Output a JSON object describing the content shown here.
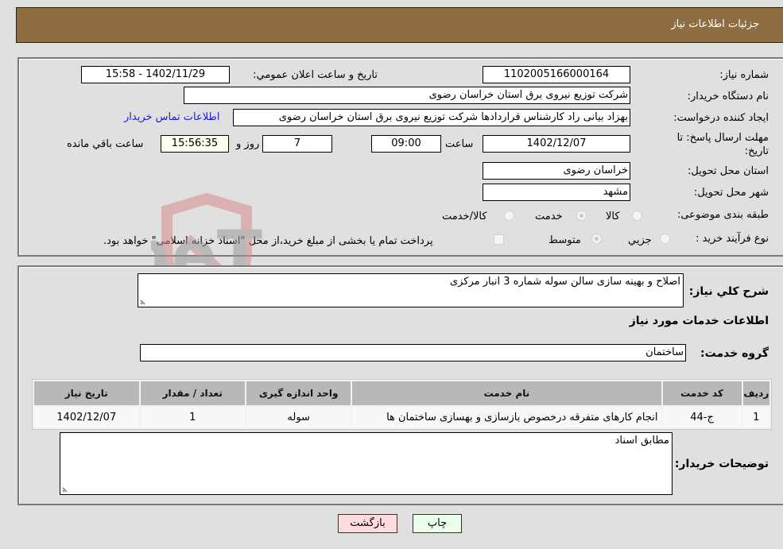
{
  "header": {
    "title": "جزئیات اطلاعات نیاز"
  },
  "form": {
    "need_number_label": "شماره نیاز:",
    "need_number": "1102005166000164",
    "announce_label": "تاریخ و ساعت اعلان عمومي:",
    "announce_value": "1402/11/29 - 15:58",
    "buyer_org_label": "نام دستگاه خریدار:",
    "buyer_org": "شرکت توزیع نیروی برق استان خراسان رضوی",
    "creator_label": "ایجاد کننده درخواست:",
    "creator": "بهزاد بیانی راد کارشناس قراردادها شرکت توزیع نیروی برق استان خراسان رضوی",
    "contact_link": "اطلاعات تماس خریدار",
    "deadline_label_1": "مهلت ارسال پاسخ: تا",
    "deadline_label_2": "تاریخ:",
    "deadline_date": "1402/12/07",
    "time_label": "ساعت",
    "deadline_time": "09:00",
    "days_value": "7",
    "days_label": "روز و",
    "remaining_time": "15:56:35",
    "remaining_label": "ساعت باقي مانده",
    "province_label": "استان محل تحویل:",
    "province": "خراسان رضوی",
    "city_label": "شهر محل تحویل:",
    "city": "مشهد",
    "category_label": "طبقه بندی موضوعی:",
    "category_options": [
      "کالا",
      "خدمت",
      "کالا/خدمت"
    ],
    "category_selected": "خدمت",
    "process_label": "نوع فرآیند خرید :",
    "process_options": [
      "جزيي",
      "متوسط"
    ],
    "process_selected": "متوسط",
    "treasury_note": "پرداخت تمام یا بخشی از مبلغ خرید،از محل \"اسناد خزانه اسلامی\" خواهد بود."
  },
  "details": {
    "description_label": "شرح کلي نیاز:",
    "description": "اصلاح و بهینه سازی سالن سوله شماره 3 انبار مرکزی",
    "services_heading": "اطلاعات خدمات مورد نیاز",
    "service_group_label": "گروه خدمت:",
    "service_group": "ساختمان",
    "table": {
      "headers": [
        "ردیف",
        "کد خدمت",
        "نام خدمت",
        "واحد اندازه گیری",
        "تعداد / مقدار",
        "تاریخ نیاز"
      ],
      "rows": [
        [
          "1",
          "ج-44",
          "انجام کارهای متفرقه درخصوص بازسازی و بهسازی ساختمان ها",
          "سوله",
          "1",
          "1402/12/07"
        ]
      ]
    },
    "buyer_notes_label": "توضیحات خریدار:",
    "buyer_notes": "مطابق اسناد"
  },
  "buttons": {
    "print": "چاپ",
    "back": "بازگشت"
  },
  "watermark": {
    "text": "AriaTender.neT"
  }
}
